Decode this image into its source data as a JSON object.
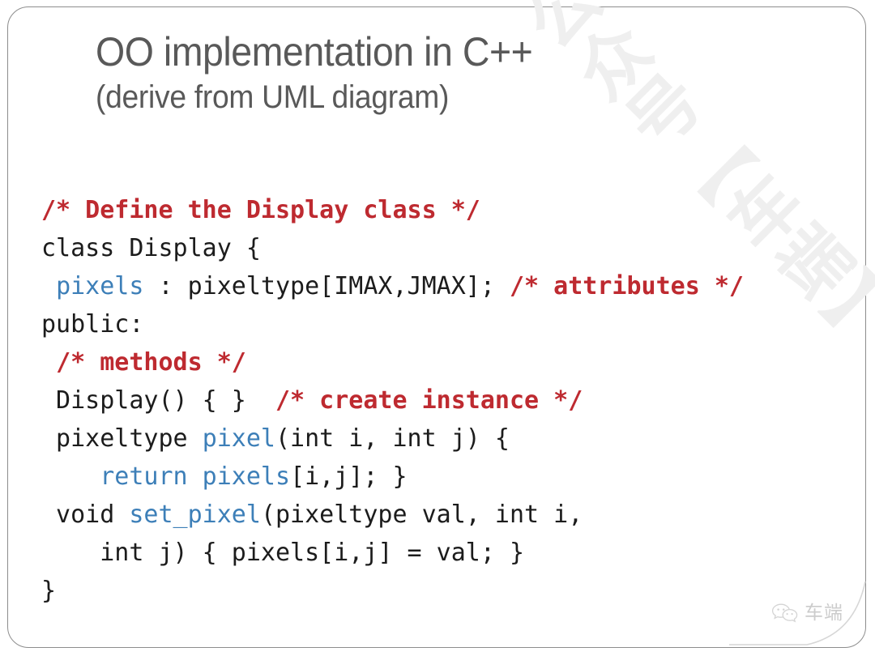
{
  "slide": {
    "title_main": "OO implementation in C++",
    "title_sub": "(derive from UML diagram)",
    "title_color": "#595959",
    "background_color": "#ffffff",
    "border_color": "#8d8d8d"
  },
  "watermark": {
    "text": "公众号【车端】",
    "color": "#efefef",
    "rotation_deg": -45
  },
  "footer": {
    "icon_name": "wechat-icon",
    "label": "车端",
    "color": "#b9b9b9"
  },
  "code": {
    "language": "C++",
    "colors": {
      "comment": "#be2a30",
      "identifier": "#3d7fb8",
      "plain": "#1c1c1c"
    },
    "lines": [
      {
        "id": "line-1",
        "tokens": [
          {
            "t": "comment",
            "s": "/* Define the Display class */"
          }
        ]
      },
      {
        "id": "line-2",
        "tokens": [
          {
            "t": "plain",
            "s": "class Display {"
          }
        ]
      },
      {
        "id": "line-3",
        "tokens": [
          {
            "t": "plain",
            "s": " "
          },
          {
            "t": "ident",
            "s": "pixels"
          },
          {
            "t": "plain",
            "s": " : pixeltype[IMAX,JMAX]; "
          },
          {
            "t": "comment",
            "s": "/* attributes */"
          }
        ]
      },
      {
        "id": "line-4",
        "tokens": [
          {
            "t": "plain",
            "s": "public:"
          }
        ]
      },
      {
        "id": "line-5",
        "tokens": [
          {
            "t": "plain",
            "s": " "
          },
          {
            "t": "comment",
            "s": "/* methods */"
          }
        ]
      },
      {
        "id": "line-6",
        "tokens": [
          {
            "t": "plain",
            "s": " Display() { }  "
          },
          {
            "t": "comment",
            "s": "/* create instance */"
          }
        ]
      },
      {
        "id": "line-7",
        "tokens": [
          {
            "t": "plain",
            "s": " pixeltype "
          },
          {
            "t": "ident",
            "s": "pixel"
          },
          {
            "t": "plain",
            "s": "(int i, int j) {"
          }
        ]
      },
      {
        "id": "line-8",
        "tokens": [
          {
            "t": "plain",
            "s": "    "
          },
          {
            "t": "ident",
            "s": "return pixels"
          },
          {
            "t": "plain",
            "s": "[i,j]; }"
          }
        ]
      },
      {
        "id": "line-9",
        "tokens": [
          {
            "t": "plain",
            "s": " void "
          },
          {
            "t": "ident",
            "s": "set_pixel"
          },
          {
            "t": "plain",
            "s": "(pixeltype val, int i,"
          }
        ]
      },
      {
        "id": "line-10",
        "tokens": [
          {
            "t": "plain",
            "s": "    int j) { pixels[i,j] = val; }"
          }
        ]
      },
      {
        "id": "line-11",
        "tokens": [
          {
            "t": "plain",
            "s": "}"
          }
        ]
      }
    ]
  }
}
